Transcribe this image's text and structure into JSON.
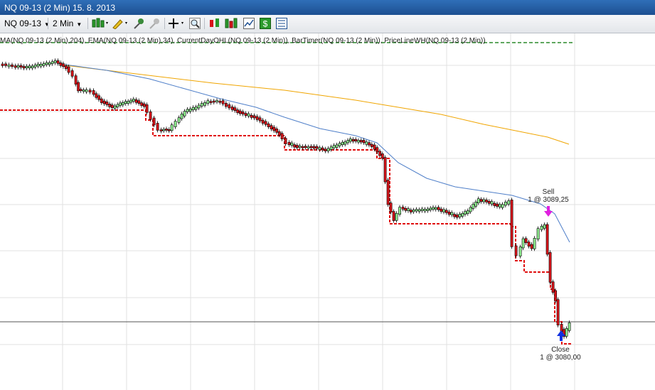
{
  "window": {
    "title": "NQ 09-13 (2 Min)  15. 8. 2013"
  },
  "toolbar": {
    "instrument": "NQ 09-13",
    "interval": "2 Min",
    "buttons": [
      "candlestick-style-icon",
      "pencil-draw-icon",
      "pin-icon",
      "pin-gray-icon",
      "crosshair-icon",
      "zoom-icon",
      "strategy-icon",
      "bars-icon",
      "chart-trader-icon",
      "dollar-icon",
      "properties-icon"
    ]
  },
  "indicators_label": "MA(NQ 09-13 (2 Min),204), EMA(NQ 09-13 (2 Min),34), CurrentDayOHL(NQ 09-13 (2 Min)), BarTimer(NQ 09-13 (2 Min)), PriceLineWH(NQ 09-13 (2 Min))",
  "annotations": {
    "sell_label": "Sell",
    "sell_detail": "1 @ 3089,25",
    "close_label": "Close",
    "close_detail": "1 @ 3080,00"
  },
  "colors": {
    "up_candle": "#90ee90",
    "down_candle": "#d9141a",
    "ema_line": "#4f7fc9",
    "ma_line": "#f0a500",
    "low_line": "#e01010",
    "sell_arrow": "#e020e0",
    "buy_arrow": "#1030e0"
  },
  "chart_data": {
    "type": "candlestick",
    "instrument": "NQ 09-13",
    "interval": "2 Min",
    "price_scale_visible": false,
    "trades": [
      {
        "action": "Sell",
        "quantity": 1,
        "price": 3089.25
      },
      {
        "action": "Close",
        "quantity": 1,
        "price": 3080.0
      }
    ],
    "series": [
      {
        "name": "MA(NQ 09-13 (2 Min),204)",
        "kind": "line"
      },
      {
        "name": "EMA(NQ 09-13 (2 Min),34)",
        "kind": "line"
      },
      {
        "name": "CurrentDayOHL(NQ 09-13 (2 Min))",
        "kind": "step-dashed"
      }
    ]
  }
}
